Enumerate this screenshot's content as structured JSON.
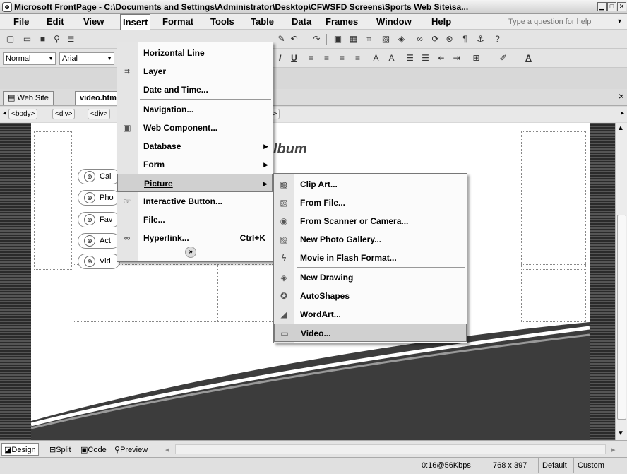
{
  "window": {
    "title": "Microsoft FrontPage - C:\\Documents and Settings\\Administrator\\Desktop\\CFWSFD Screens\\Sports Web Site\\sa...",
    "min": "▁",
    "max": "□",
    "close": "✕"
  },
  "menubar": {
    "items": [
      "File",
      "Edit",
      "View",
      "Insert",
      "Format",
      "Tools",
      "Table",
      "Data",
      "Frames",
      "Window",
      "Help"
    ],
    "help_placeholder": "Type a question for help",
    "help_arrow": "▾"
  },
  "toolbar": {
    "style": "Normal",
    "font": "Arial"
  },
  "tabs": {
    "website": "Web Site",
    "document": "video.htm",
    "close": "×"
  },
  "tag_path": [
    "<body>",
    "<div>",
    "<div>"
  ],
  "tag_tail": "nt>",
  "page": {
    "heading_fragment": "lbum",
    "links": [
      "Cal",
      "Pho",
      "Fav",
      "Act",
      "Vid"
    ]
  },
  "insert_menu": {
    "items": [
      {
        "label": "Horizontal Line",
        "icon": ""
      },
      {
        "label": "Layer",
        "icon": "layer-icon"
      },
      {
        "label": "Date and Time...",
        "icon": ""
      },
      {
        "label": "Navigation...",
        "icon": ""
      },
      {
        "label": "Web Component...",
        "icon": "web-component-icon"
      },
      {
        "label": "Database",
        "icon": "",
        "submenu": true
      },
      {
        "label": "Form",
        "icon": "",
        "submenu": true
      },
      {
        "label": "Picture",
        "icon": "",
        "submenu": true
      },
      {
        "label": "Interactive Button...",
        "icon": "interactive-button-icon"
      },
      {
        "label": "File...",
        "icon": ""
      },
      {
        "label": "Hyperlink...",
        "icon": "hyperlink-icon",
        "shortcut": "Ctrl+K"
      }
    ],
    "expand": "»"
  },
  "picture_menu": {
    "items": [
      {
        "label": "Clip Art...",
        "icon": "clip-art-icon"
      },
      {
        "label": "From File...",
        "icon": "from-file-icon"
      },
      {
        "label": "From Scanner or Camera...",
        "icon": "scanner-icon"
      },
      {
        "label": "New Photo Gallery...",
        "icon": "photo-gallery-icon"
      },
      {
        "label": "Movie in Flash Format...",
        "icon": "flash-icon"
      },
      {
        "label": "New Drawing",
        "icon": "drawing-icon"
      },
      {
        "label": "AutoShapes",
        "icon": "autoshapes-icon"
      },
      {
        "label": "WordArt...",
        "icon": "wordart-icon"
      },
      {
        "label": "Video...",
        "icon": "video-icon"
      }
    ]
  },
  "views": [
    "Design",
    "Split",
    "Code",
    "Preview"
  ],
  "status": {
    "time": "0:16@56Kbps",
    "size": "768 x 397",
    "mode": "Default",
    "custom": "Custom"
  }
}
